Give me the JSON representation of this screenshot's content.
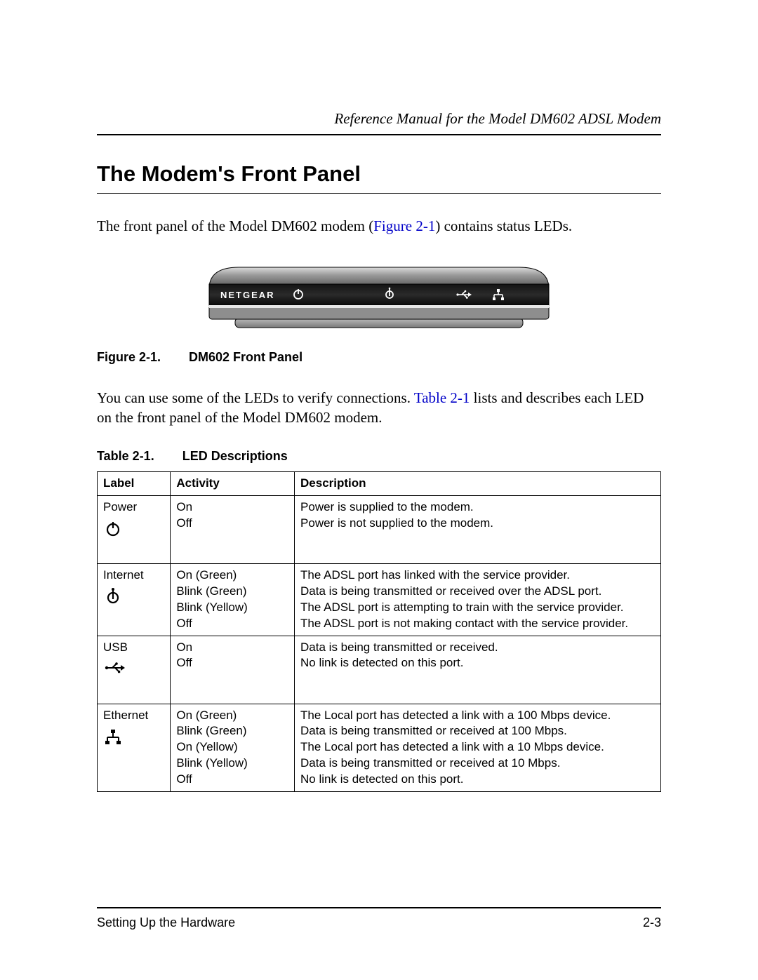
{
  "header": {
    "running": "Reference Manual for the Model DM602 ADSL Modem"
  },
  "title": "The Modem's Front Panel",
  "para1": {
    "a": "The front panel of the Model DM602 modem (",
    "link": "Figure 2-1",
    "b": ") contains status LEDs."
  },
  "figure": {
    "brand": "NETGEAR",
    "caption_no": "Figure 2-1.",
    "caption_text": "DM602 Front Panel",
    "icons": [
      "power-icon",
      "internet-icon",
      "usb-icon",
      "ethernet-icon"
    ]
  },
  "para2": {
    "a": "You can use some of the LEDs to verify connections. ",
    "link": "Table 2-1",
    "b": " lists and describes each LED on the front panel of the Model DM602 modem."
  },
  "table": {
    "caption_no": "Table 2-1.",
    "caption_text": "LED Descriptions",
    "headers": [
      "Label",
      "Activity",
      "Description"
    ],
    "rows": [
      {
        "label": "Power",
        "icon": "power-icon",
        "activity": [
          "On",
          "Off"
        ],
        "description": [
          "Power is supplied to the modem.",
          "Power is not supplied to the modem."
        ]
      },
      {
        "label": "Internet",
        "icon": "internet-icon",
        "activity": [
          "On (Green)",
          "Blink (Green)",
          "Blink (Yellow)",
          "Off"
        ],
        "description": [
          "The ADSL port has linked with the service provider.",
          "Data is being transmitted or received over the ADSL port.",
          "The ADSL port is attempting to train with the service provider.",
          "The ADSL port is not making contact with the service provider."
        ]
      },
      {
        "label": "USB",
        "icon": "usb-icon",
        "activity": [
          "On",
          "Off"
        ],
        "description": [
          "Data is being transmitted or received.",
          "No link is detected on this port."
        ]
      },
      {
        "label": "Ethernet",
        "icon": "ethernet-icon",
        "activity": [
          "On (Green)",
          "Blink (Green)",
          "On (Yellow)",
          "Blink (Yellow)",
          "Off"
        ],
        "description": [
          "The Local port has detected a link with a 100 Mbps device.",
          "Data is being transmitted or received at 100 Mbps.",
          "The Local port has detected a link with a 10 Mbps device.",
          "Data is being transmitted or received at 10 Mbps.",
          "No link is detected on this port."
        ]
      }
    ]
  },
  "footer": {
    "left": "Setting Up the Hardware",
    "right": "2-3"
  }
}
